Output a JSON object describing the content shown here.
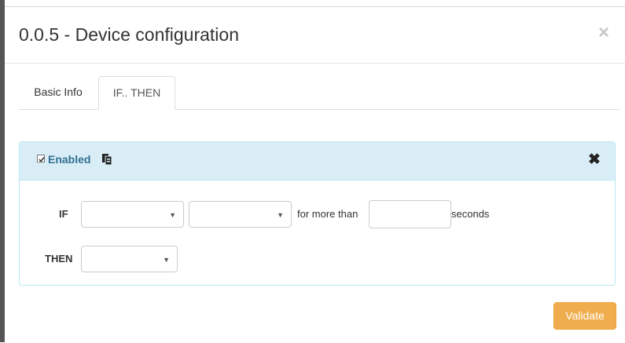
{
  "modal": {
    "title": "0.0.5 - Device configuration",
    "close_icon": "close-icon"
  },
  "tabs": [
    {
      "label": "Basic Info",
      "active": false
    },
    {
      "label": "IF.. THEN",
      "active": true
    }
  ],
  "rule": {
    "enabled_checked": true,
    "enabled_label": "Enabled",
    "copy_icon": "copy-icon",
    "remove_icon": "remove-icon",
    "if_label": "IF",
    "if_select_1_value": "",
    "if_select_2_value": "",
    "for_more_than_label": "for more than",
    "seconds_value": "",
    "seconds_label": "seconds",
    "then_label": "THEN",
    "then_select_value": ""
  },
  "footer": {
    "validate_label": "Validate",
    "validate_color": "#f0ad4e"
  }
}
